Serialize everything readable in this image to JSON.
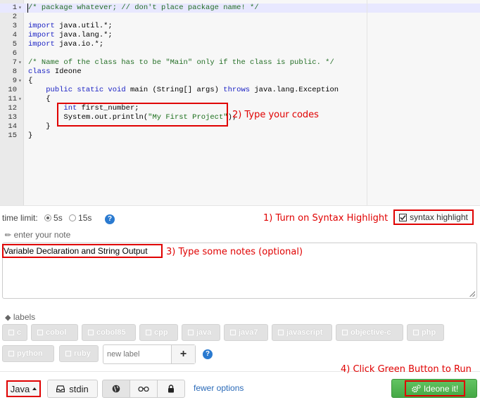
{
  "editor": {
    "lines": [
      {
        "n": "1",
        "fold": "▾",
        "tokens": [
          {
            "c": "c-cm",
            "t": "/* package whatever; // don't place package name! */"
          }
        ]
      },
      {
        "n": "2",
        "fold": "",
        "tokens": []
      },
      {
        "n": "3",
        "fold": "",
        "tokens": [
          {
            "c": "c-kw",
            "t": "import"
          },
          {
            "c": "c-pl",
            "t": " java.util.*;"
          }
        ]
      },
      {
        "n": "4",
        "fold": "",
        "tokens": [
          {
            "c": "c-kw",
            "t": "import"
          },
          {
            "c": "c-pl",
            "t": " java.lang.*;"
          }
        ]
      },
      {
        "n": "5",
        "fold": "",
        "tokens": [
          {
            "c": "c-kw",
            "t": "import"
          },
          {
            "c": "c-pl",
            "t": " java.io.*;"
          }
        ]
      },
      {
        "n": "6",
        "fold": "",
        "tokens": []
      },
      {
        "n": "7",
        "fold": "▾",
        "tokens": [
          {
            "c": "c-cm",
            "t": "/* Name of the class has to be \"Main\" only if the class is public. */"
          }
        ]
      },
      {
        "n": "8",
        "fold": "",
        "tokens": [
          {
            "c": "c-kw",
            "t": "class"
          },
          {
            "c": "c-pl",
            "t": " Ideone"
          }
        ]
      },
      {
        "n": "9",
        "fold": "▾",
        "tokens": [
          {
            "c": "c-pl",
            "t": "{"
          }
        ]
      },
      {
        "n": "10",
        "fold": "",
        "tokens": [
          {
            "c": "c-pl",
            "t": "    "
          },
          {
            "c": "c-kw",
            "t": "public static void"
          },
          {
            "c": "c-pl",
            "t": " main (String[] args) "
          },
          {
            "c": "c-kw",
            "t": "throws"
          },
          {
            "c": "c-pl",
            "t": " java.lang.Exception"
          }
        ]
      },
      {
        "n": "11",
        "fold": "▾",
        "tokens": [
          {
            "c": "c-pl",
            "t": "    {"
          }
        ]
      },
      {
        "n": "12",
        "fold": "",
        "tokens": [
          {
            "c": "c-pl",
            "t": "        "
          },
          {
            "c": "c-kw",
            "t": "int"
          },
          {
            "c": "c-pl",
            "t": " first_number;"
          }
        ]
      },
      {
        "n": "13",
        "fold": "",
        "tokens": [
          {
            "c": "c-pl",
            "t": "        System.out.println("
          },
          {
            "c": "c-str",
            "t": "\"My First Project\""
          },
          {
            "c": "c-pl",
            "t": ");"
          }
        ]
      },
      {
        "n": "14",
        "fold": "",
        "tokens": [
          {
            "c": "c-pl",
            "t": "    }"
          }
        ]
      },
      {
        "n": "15",
        "fold": "",
        "tokens": [
          {
            "c": "c-pl",
            "t": "}"
          }
        ]
      }
    ]
  },
  "annotations": {
    "step1": "1) Turn on Syntax Highlight",
    "step2": "2) Type your codes",
    "step3": "3) Type some notes (optional)",
    "step4": "4) Click Green Button to Run"
  },
  "options": {
    "time_limit_label": "time limit:",
    "opt_5s": "5s",
    "opt_15s": "15s",
    "selected": "5s",
    "syntax_highlight": "syntax highlight"
  },
  "note": {
    "label": "enter your note",
    "value": "Variable Declaration and String Output"
  },
  "labels": {
    "title": "labels",
    "tags_row1": [
      "c",
      "cobol",
      "cobol85",
      "cpp",
      "java",
      "java7",
      "javascript",
      "objective-c",
      "php"
    ],
    "tags_row2": [
      "python",
      "ruby"
    ],
    "new_label_placeholder": "new label",
    "add": "+"
  },
  "bottom": {
    "language": "Java",
    "stdin": "stdin",
    "fewer_options": "fewer options",
    "run": "Ideone it!"
  },
  "colors": {
    "annotation_red": "#e00000",
    "run_green": "#51b351",
    "link_blue": "#2a6ab8"
  }
}
